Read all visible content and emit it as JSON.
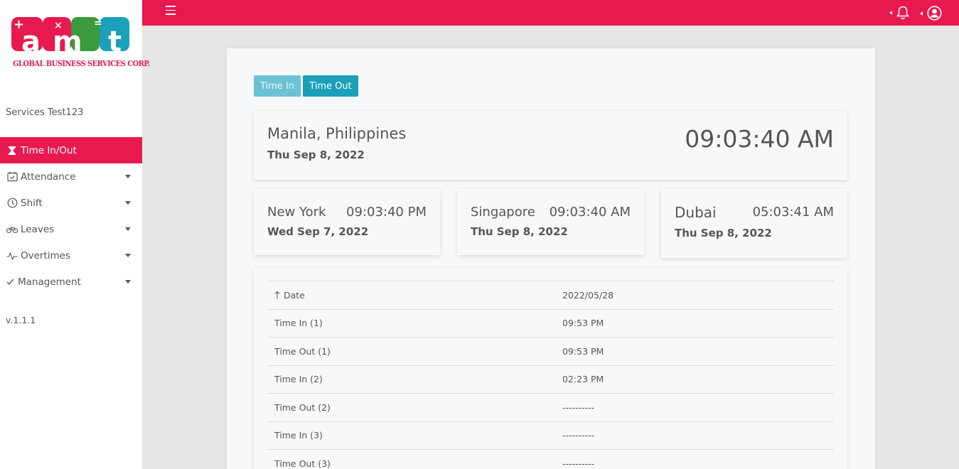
{
  "sidebar": {
    "logo_text": "GLOBAL BUSINESS SERVICES CORP.",
    "user_name": "Services Test123",
    "items": [
      {
        "label": "Time In/Out",
        "icon": "hourglass-icon",
        "active": true
      },
      {
        "label": "Attendance",
        "icon": "calendar-check-icon"
      },
      {
        "label": "Shift",
        "icon": "clock-icon"
      },
      {
        "label": "Leaves",
        "icon": "bicycle-icon"
      },
      {
        "label": "Overtimes",
        "icon": "pulse-icon"
      },
      {
        "label": "Management",
        "icon": "check-icon"
      }
    ],
    "version": "v.1.1.1"
  },
  "topbar": {
    "menu_icon": "hamburger-icon",
    "notification_icon": "bell-icon",
    "profile_icon": "user-circle-icon"
  },
  "buttons": {
    "time_in": "Time In",
    "time_out": "Time Out"
  },
  "clocks": {
    "main": {
      "city": "Manila, Philippines",
      "date": "Thu Sep 8, 2022",
      "time": "09:03:40 AM"
    },
    "others": [
      {
        "city": "New York",
        "time": "09:03:40 PM",
        "date": "Wed Sep 7, 2022"
      },
      {
        "city": "Singapore",
        "time": "09:03:40 AM",
        "date": "Thu Sep 8, 2022"
      },
      {
        "city": "Dubai",
        "time": "05:03:41 AM",
        "date": "Thu Sep 8, 2022"
      }
    ]
  },
  "records": {
    "rows": [
      {
        "label": "Date",
        "value": "2022/05/28"
      },
      {
        "label": "Time In (1)",
        "value": "09:53 PM"
      },
      {
        "label": "Time Out (1)",
        "value": "09:53 PM"
      },
      {
        "label": "Time In (2)",
        "value": "02:23 PM"
      },
      {
        "label": "Time Out (2)",
        "value": "----------"
      },
      {
        "label": "Time In (3)",
        "value": "----------"
      },
      {
        "label": "Time Out (3)",
        "value": "----------"
      }
    ]
  },
  "colors": {
    "brand": "#e8194f",
    "button_primary": "#1aa0b9",
    "button_light": "#6cc1d4"
  }
}
